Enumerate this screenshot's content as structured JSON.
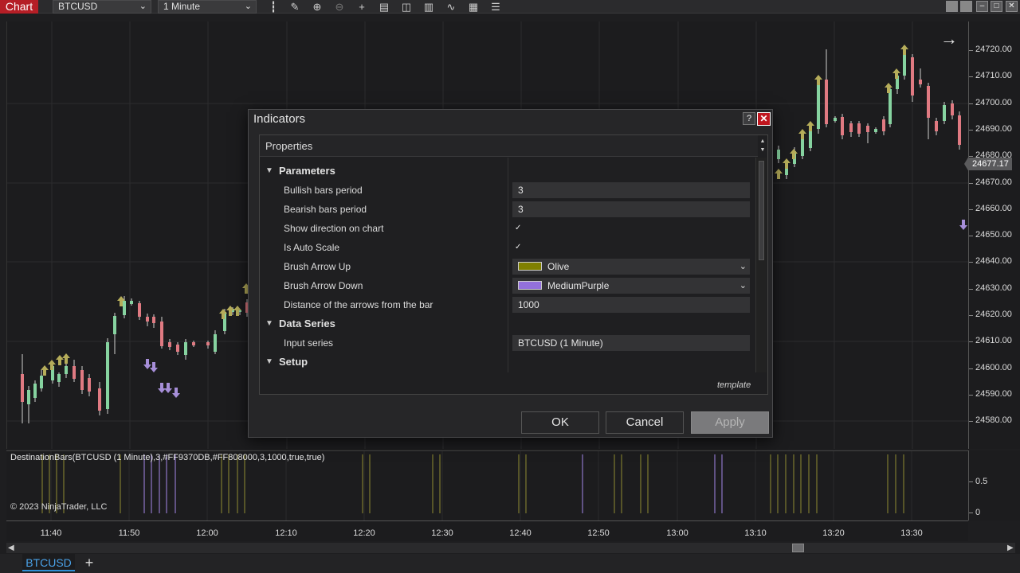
{
  "toolbar": {
    "chart_label": "Chart",
    "instrument": "BTCUSD",
    "interval": "1 Minute",
    "icons": [
      "bar-type-icon",
      "drawing-pencil-icon",
      "zoom-in-icon",
      "zoom-out-icon",
      "crosshair-icon",
      "data-box-icon",
      "chart-trader-icon",
      "properties-icon",
      "strategies-icon",
      "snapshot-icon",
      "more-icon"
    ]
  },
  "price_axis": {
    "labels": [
      "24720.00",
      "24710.00",
      "24700.00",
      "24690.00",
      "24680.00",
      "24670.00",
      "24660.00",
      "24650.00",
      "24640.00",
      "24630.00",
      "24620.00",
      "24610.00",
      "24600.00",
      "24590.00",
      "24580.00"
    ],
    "last_price": "24677.17"
  },
  "indicator_panel": {
    "title": "DestinationBars(BTCUSD (1 Minute),3,#FF9370DB,#FF808000,3,1000,true,true)",
    "axis_labels": [
      "0.5",
      "0"
    ],
    "copyright": "© 2023 NinjaTrader, LLC"
  },
  "time_axis": {
    "labels": [
      "11:40",
      "11:50",
      "12:00",
      "12:10",
      "12:20",
      "12:30",
      "12:40",
      "12:50",
      "13:00",
      "13:10",
      "13:20",
      "13:30"
    ]
  },
  "tabs": {
    "active": "BTCUSD",
    "add": "+"
  },
  "colors": {
    "up_arrow": "#808000",
    "down_arrow": "#9370DB",
    "accent": "#b51e26",
    "tab_accent": "#2e8fd6"
  },
  "dialog": {
    "title": "Indicators",
    "help": "?",
    "close": "✕",
    "props_header": "Properties",
    "sections": {
      "parameters": "Parameters",
      "data_series": "Data Series",
      "setup": "Setup"
    },
    "params": {
      "bullish_label": "Bullish bars period",
      "bullish_value": "3",
      "bearish_label": "Bearish bars period",
      "bearish_value": "3",
      "show_dir_label": "Show direction on chart",
      "show_dir_value": "✓",
      "auto_scale_label": "Is Auto Scale",
      "auto_scale_value": "✓",
      "brush_up_label": "Brush Arrow Up",
      "brush_up_value": "Olive",
      "brush_down_label": "Brush Arrow Down",
      "brush_down_value": "MediumPurple",
      "distance_label": "Distance of the arrows from the bar",
      "distance_value": "1000",
      "input_series_label": "Input series",
      "input_series_value": "BTCUSD (1 Minute)"
    },
    "template": "template",
    "ok": "OK",
    "cancel": "Cancel",
    "apply": "Apply"
  }
}
